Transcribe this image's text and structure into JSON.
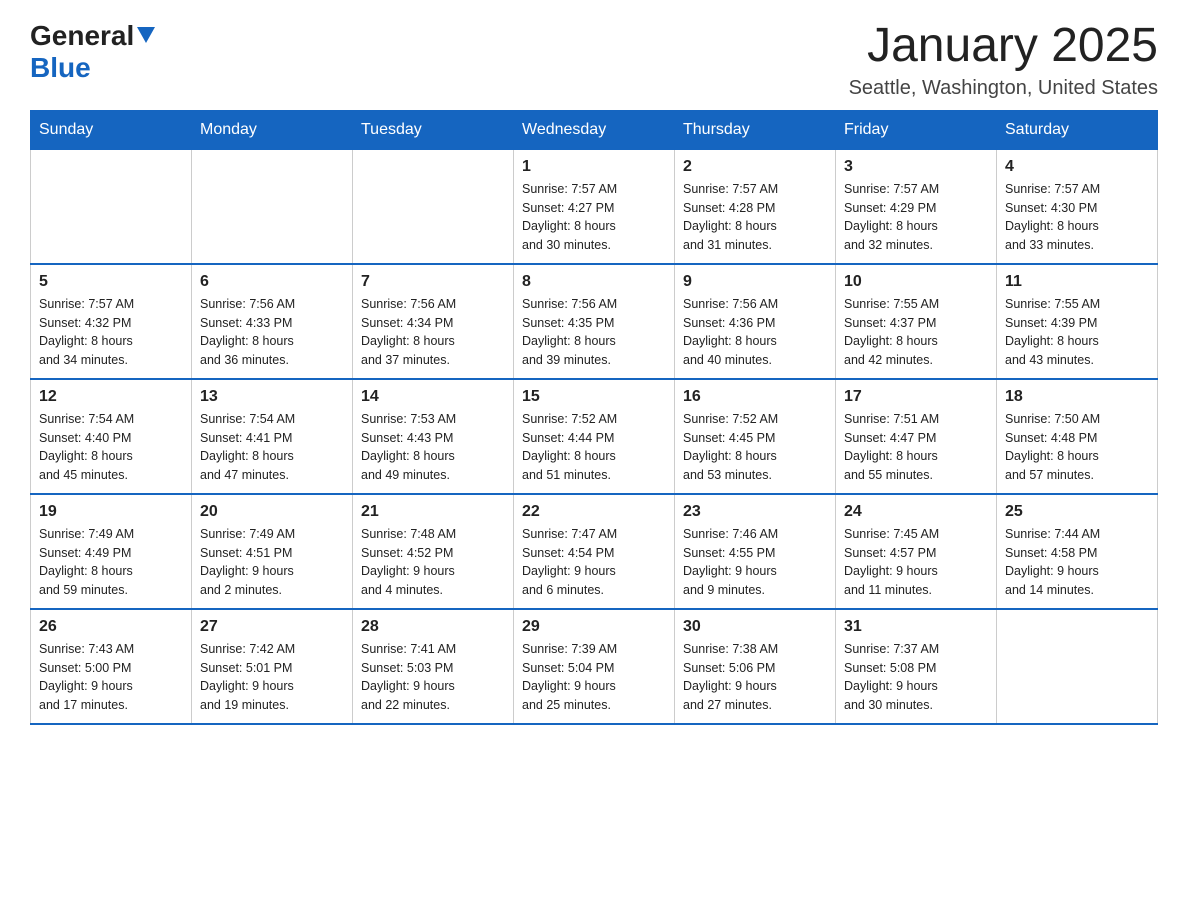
{
  "header": {
    "logo_general": "General",
    "logo_blue": "Blue",
    "month_title": "January 2025",
    "location": "Seattle, Washington, United States"
  },
  "days_of_week": [
    "Sunday",
    "Monday",
    "Tuesday",
    "Wednesday",
    "Thursday",
    "Friday",
    "Saturday"
  ],
  "weeks": [
    [
      {
        "day": "",
        "info": ""
      },
      {
        "day": "",
        "info": ""
      },
      {
        "day": "",
        "info": ""
      },
      {
        "day": "1",
        "info": "Sunrise: 7:57 AM\nSunset: 4:27 PM\nDaylight: 8 hours\nand 30 minutes."
      },
      {
        "day": "2",
        "info": "Sunrise: 7:57 AM\nSunset: 4:28 PM\nDaylight: 8 hours\nand 31 minutes."
      },
      {
        "day": "3",
        "info": "Sunrise: 7:57 AM\nSunset: 4:29 PM\nDaylight: 8 hours\nand 32 minutes."
      },
      {
        "day": "4",
        "info": "Sunrise: 7:57 AM\nSunset: 4:30 PM\nDaylight: 8 hours\nand 33 minutes."
      }
    ],
    [
      {
        "day": "5",
        "info": "Sunrise: 7:57 AM\nSunset: 4:32 PM\nDaylight: 8 hours\nand 34 minutes."
      },
      {
        "day": "6",
        "info": "Sunrise: 7:56 AM\nSunset: 4:33 PM\nDaylight: 8 hours\nand 36 minutes."
      },
      {
        "day": "7",
        "info": "Sunrise: 7:56 AM\nSunset: 4:34 PM\nDaylight: 8 hours\nand 37 minutes."
      },
      {
        "day": "8",
        "info": "Sunrise: 7:56 AM\nSunset: 4:35 PM\nDaylight: 8 hours\nand 39 minutes."
      },
      {
        "day": "9",
        "info": "Sunrise: 7:56 AM\nSunset: 4:36 PM\nDaylight: 8 hours\nand 40 minutes."
      },
      {
        "day": "10",
        "info": "Sunrise: 7:55 AM\nSunset: 4:37 PM\nDaylight: 8 hours\nand 42 minutes."
      },
      {
        "day": "11",
        "info": "Sunrise: 7:55 AM\nSunset: 4:39 PM\nDaylight: 8 hours\nand 43 minutes."
      }
    ],
    [
      {
        "day": "12",
        "info": "Sunrise: 7:54 AM\nSunset: 4:40 PM\nDaylight: 8 hours\nand 45 minutes."
      },
      {
        "day": "13",
        "info": "Sunrise: 7:54 AM\nSunset: 4:41 PM\nDaylight: 8 hours\nand 47 minutes."
      },
      {
        "day": "14",
        "info": "Sunrise: 7:53 AM\nSunset: 4:43 PM\nDaylight: 8 hours\nand 49 minutes."
      },
      {
        "day": "15",
        "info": "Sunrise: 7:52 AM\nSunset: 4:44 PM\nDaylight: 8 hours\nand 51 minutes."
      },
      {
        "day": "16",
        "info": "Sunrise: 7:52 AM\nSunset: 4:45 PM\nDaylight: 8 hours\nand 53 minutes."
      },
      {
        "day": "17",
        "info": "Sunrise: 7:51 AM\nSunset: 4:47 PM\nDaylight: 8 hours\nand 55 minutes."
      },
      {
        "day": "18",
        "info": "Sunrise: 7:50 AM\nSunset: 4:48 PM\nDaylight: 8 hours\nand 57 minutes."
      }
    ],
    [
      {
        "day": "19",
        "info": "Sunrise: 7:49 AM\nSunset: 4:49 PM\nDaylight: 8 hours\nand 59 minutes."
      },
      {
        "day": "20",
        "info": "Sunrise: 7:49 AM\nSunset: 4:51 PM\nDaylight: 9 hours\nand 2 minutes."
      },
      {
        "day": "21",
        "info": "Sunrise: 7:48 AM\nSunset: 4:52 PM\nDaylight: 9 hours\nand 4 minutes."
      },
      {
        "day": "22",
        "info": "Sunrise: 7:47 AM\nSunset: 4:54 PM\nDaylight: 9 hours\nand 6 minutes."
      },
      {
        "day": "23",
        "info": "Sunrise: 7:46 AM\nSunset: 4:55 PM\nDaylight: 9 hours\nand 9 minutes."
      },
      {
        "day": "24",
        "info": "Sunrise: 7:45 AM\nSunset: 4:57 PM\nDaylight: 9 hours\nand 11 minutes."
      },
      {
        "day": "25",
        "info": "Sunrise: 7:44 AM\nSunset: 4:58 PM\nDaylight: 9 hours\nand 14 minutes."
      }
    ],
    [
      {
        "day": "26",
        "info": "Sunrise: 7:43 AM\nSunset: 5:00 PM\nDaylight: 9 hours\nand 17 minutes."
      },
      {
        "day": "27",
        "info": "Sunrise: 7:42 AM\nSunset: 5:01 PM\nDaylight: 9 hours\nand 19 minutes."
      },
      {
        "day": "28",
        "info": "Sunrise: 7:41 AM\nSunset: 5:03 PM\nDaylight: 9 hours\nand 22 minutes."
      },
      {
        "day": "29",
        "info": "Sunrise: 7:39 AM\nSunset: 5:04 PM\nDaylight: 9 hours\nand 25 minutes."
      },
      {
        "day": "30",
        "info": "Sunrise: 7:38 AM\nSunset: 5:06 PM\nDaylight: 9 hours\nand 27 minutes."
      },
      {
        "day": "31",
        "info": "Sunrise: 7:37 AM\nSunset: 5:08 PM\nDaylight: 9 hours\nand 30 minutes."
      },
      {
        "day": "",
        "info": ""
      }
    ]
  ]
}
